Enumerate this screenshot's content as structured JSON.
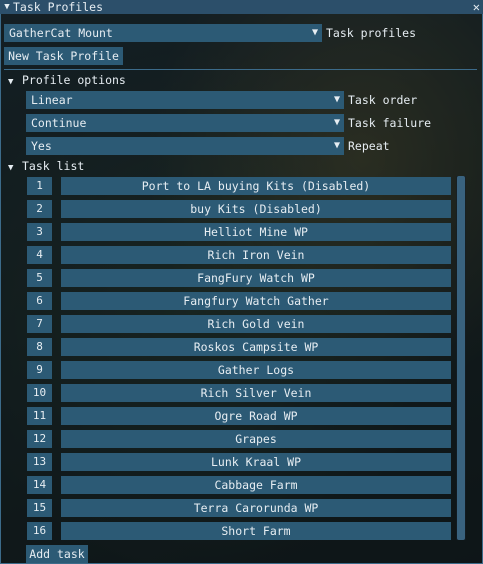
{
  "window": {
    "title": "Task Profiles",
    "collapse_glyph": "▼",
    "close_glyph": "✕"
  },
  "profile": {
    "selected": "GatherCat Mount",
    "label": "Task profiles",
    "new_button": "New Task Profile"
  },
  "profile_options": {
    "header": "Profile options",
    "task_order": {
      "value": "Linear",
      "label": "Task order"
    },
    "task_failure": {
      "value": "Continue",
      "label": "Task failure"
    },
    "repeat": {
      "value": "Yes",
      "label": "Repeat"
    }
  },
  "task_list": {
    "header": "Task list",
    "tasks": [
      {
        "n": "1",
        "name": "Port to LA buying Kits (Disabled)"
      },
      {
        "n": "2",
        "name": "buy Kits (Disabled)"
      },
      {
        "n": "3",
        "name": "Helliot Mine WP"
      },
      {
        "n": "4",
        "name": "Rich Iron Vein"
      },
      {
        "n": "5",
        "name": "FangFury Watch WP"
      },
      {
        "n": "6",
        "name": "Fangfury Watch Gather"
      },
      {
        "n": "7",
        "name": "Rich Gold vein"
      },
      {
        "n": "8",
        "name": "Roskos Campsite WP"
      },
      {
        "n": "9",
        "name": "Gather Logs"
      },
      {
        "n": "10",
        "name": "Rich Silver Vein"
      },
      {
        "n": "11",
        "name": "Ogre Road WP"
      },
      {
        "n": "12",
        "name": "Grapes"
      },
      {
        "n": "13",
        "name": "Lunk Kraal WP"
      },
      {
        "n": "14",
        "name": "Cabbage Farm"
      },
      {
        "n": "15",
        "name": "Terra Carorunda WP"
      },
      {
        "n": "16",
        "name": "Short Farm"
      }
    ],
    "add_button": "Add task"
  },
  "icons": {
    "dropdown": "chevron-down-icon",
    "tree_open": "triangle-down-icon"
  },
  "colors": {
    "title_bar": "#2c4f6a",
    "widget": "#2c5a75",
    "border": "#3c6b8a",
    "text": "#e6edf2"
  }
}
